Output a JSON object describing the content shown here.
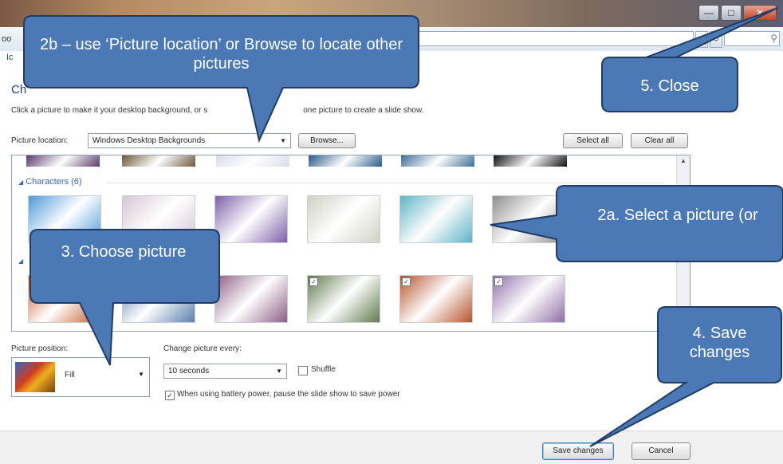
{
  "window": {
    "minimize_glyph": "—",
    "maximize_glyph": "□",
    "close_glyph": "✕"
  },
  "address_bar": {
    "left_fragment": "oo",
    "value": "",
    "search_placeholder": "",
    "icons": [
      "refresh-icon",
      "search-icon"
    ]
  },
  "left_link_fragment": "Ic",
  "page": {
    "heading": "Ch",
    "description_part1": "Click a picture to make it your desktop background, or s",
    "description_part2": "one picture to create a slide show."
  },
  "picture_location": {
    "label": "Picture location:",
    "value": "Windows Desktop Backgrounds",
    "browse_label": "Browse...",
    "select_all_label": "Select all",
    "clear_all_label": "Clear all"
  },
  "gallery": {
    "group_characters": {
      "label": "Characters (6)",
      "collapse_glyph": "◢"
    },
    "second_group_glyph": "◢",
    "top_row_colors": [
      "#5a3a6a",
      "#6b5a3e",
      "#d8dde6",
      "#2a5b8a",
      "#3f6f99",
      "#121212"
    ],
    "character_colors": [
      "#4e9ad7",
      "#d6c7d3",
      "#7e5fa8",
      "#cfd2c5",
      "#5fb3c6",
      "#8e8e8e"
    ],
    "landscape_colors": [
      "#c55a2a",
      "#5c7fae",
      "#8d5e86",
      "#5e7a4c",
      "#b5532c",
      "#8f6fa8"
    ],
    "scroll_up_glyph": "▲"
  },
  "picture_position": {
    "label": "Picture position:",
    "value": "Fill"
  },
  "slideshow": {
    "change_label": "Change picture every:",
    "interval_value": "10 seconds",
    "shuffle_label": "Shuffle",
    "shuffle_checked": false,
    "battery_label": "When using battery power, pause the slide show to save power",
    "battery_checked": true
  },
  "footer": {
    "save_label": "Save changes",
    "cancel_label": "Cancel"
  },
  "callouts": {
    "browse": "2b – use ‘Picture location’ or Browse to locate other pictures",
    "close": "5. Close",
    "select": "2a. Select a picture (or",
    "choose": "3. Choose picture",
    "save": "4. Save changes"
  },
  "colors": {
    "callout_fill": "#4a79b6",
    "callout_stroke": "#1f3b66",
    "heading_blue": "#1e3d8f",
    "group_blue": "#3668b6"
  }
}
